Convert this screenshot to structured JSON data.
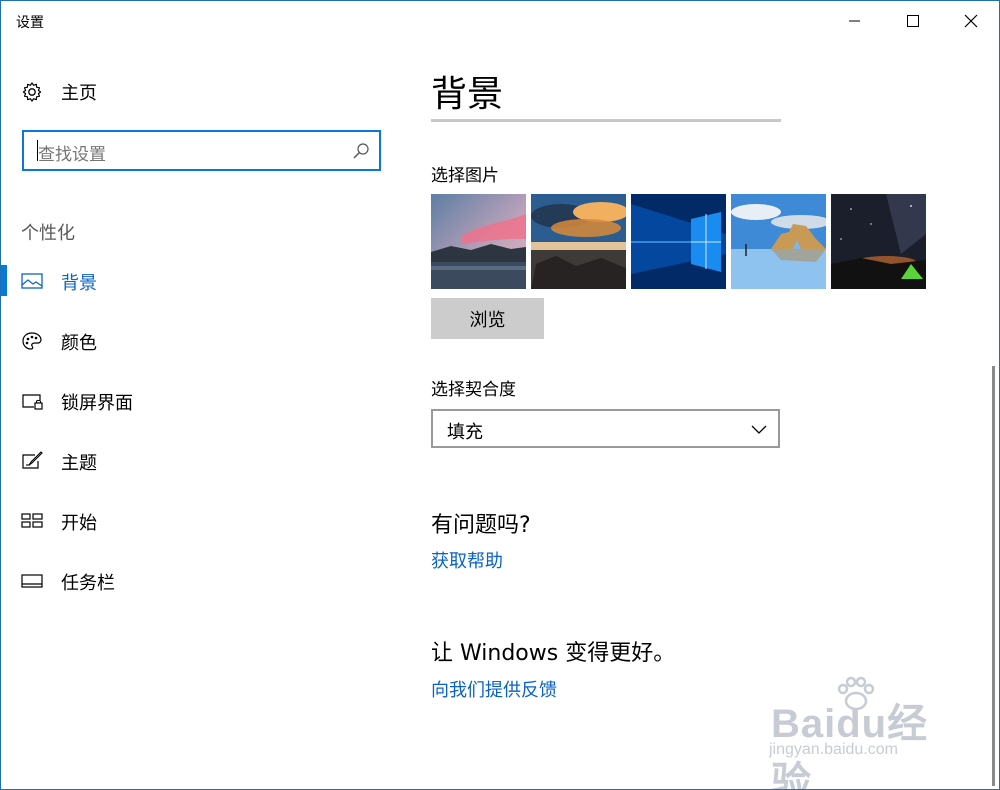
{
  "window": {
    "title": "设置"
  },
  "sidebar": {
    "home_label": "主页",
    "search_placeholder": "查找设置",
    "section_label": "个性化",
    "items": [
      {
        "label": "背景",
        "icon": "picture-icon",
        "active": true
      },
      {
        "label": "颜色",
        "icon": "palette-icon",
        "active": false
      },
      {
        "label": "锁屏界面",
        "icon": "lock-screen-icon",
        "active": false
      },
      {
        "label": "主题",
        "icon": "theme-brush-icon",
        "active": false
      },
      {
        "label": "开始",
        "icon": "start-tiles-icon",
        "active": false
      },
      {
        "label": "任务栏",
        "icon": "taskbar-icon",
        "active": false
      }
    ]
  },
  "main": {
    "title": "背景",
    "choose_picture_label": "选择图片",
    "thumbnails": [
      "sunset-lake-picture",
      "rocky-shore-clouds-picture",
      "windows-logo-light-picture",
      "beach-rock-arch-picture",
      "night-sky-tent-picture"
    ],
    "browse_label": "浏览",
    "fit_label": "选择契合度",
    "fit_value": "填充",
    "question_heading": "有问题吗?",
    "help_link": "获取帮助",
    "better_heading": "让 Windows 变得更好。",
    "feedback_link": "向我们提供反馈"
  },
  "watermark": {
    "brand": "Baidu经验",
    "url": "jingyan.baidu.com"
  },
  "colors": {
    "accent": "#0a78d7",
    "link": "#0a63c4",
    "button_bg": "#cccccc"
  }
}
